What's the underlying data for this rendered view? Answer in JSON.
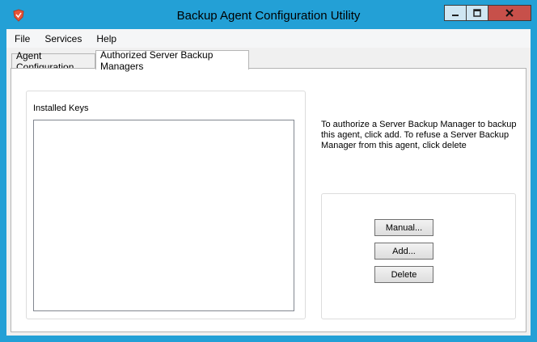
{
  "window": {
    "title": "Backup Agent Configuration Utility",
    "accent_color": "#23a0d6",
    "close_color": "#c7504a"
  },
  "menu": {
    "items": [
      "File",
      "Services",
      "Help"
    ]
  },
  "tabs": [
    {
      "label": "Agent Configuration",
      "selected": false
    },
    {
      "label": "Authorized Server Backup Managers",
      "selected": true
    }
  ],
  "panel": {
    "installed_keys_label": "Installed Keys",
    "info_text": "To authorize a Server Backup Manager to backup this agent, click add. To refuse a Server Backup Manager from this agent, click delete",
    "buttons": {
      "manual": "Manual...",
      "add": "Add...",
      "delete": "Delete"
    }
  }
}
